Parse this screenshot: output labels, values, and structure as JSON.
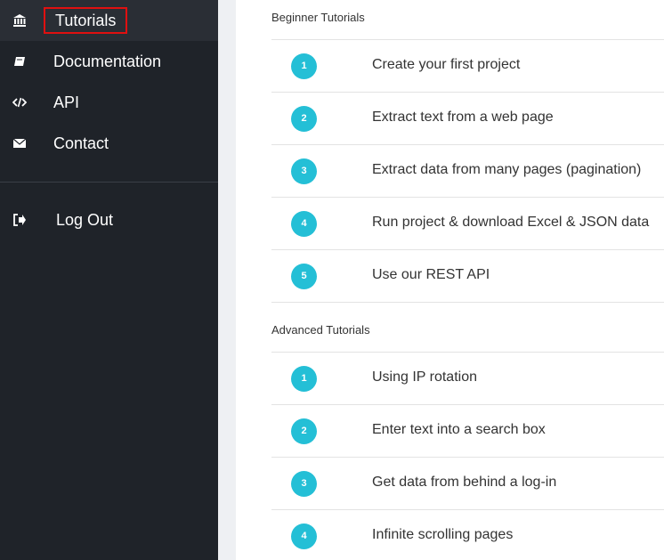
{
  "sidebar": {
    "items": [
      {
        "label": "Tutorials",
        "icon": "bank-icon"
      },
      {
        "label": "Documentation",
        "icon": "book-icon"
      },
      {
        "label": "API",
        "icon": "code-icon"
      },
      {
        "label": "Contact",
        "icon": "envelope-icon"
      }
    ],
    "logout": {
      "label": "Log Out",
      "icon": "sign-out-icon"
    }
  },
  "beginner": {
    "title": "Beginner Tutorials",
    "items": [
      {
        "num": "1",
        "label": "Create your first project"
      },
      {
        "num": "2",
        "label": "Extract text from a web page"
      },
      {
        "num": "3",
        "label": "Extract data from many pages (pagination)"
      },
      {
        "num": "4",
        "label": "Run project & download Excel & JSON data"
      },
      {
        "num": "5",
        "label": "Use our REST API"
      }
    ]
  },
  "advanced": {
    "title": "Advanced Tutorials",
    "items": [
      {
        "num": "1",
        "label": "Using IP rotation"
      },
      {
        "num": "2",
        "label": "Enter text into a search box"
      },
      {
        "num": "3",
        "label": "Get data from behind a log-in"
      },
      {
        "num": "4",
        "label": "Infinite scrolling pages"
      }
    ]
  },
  "colors": {
    "sidebar_bg": "#1f2329",
    "badge": "#24bfd6",
    "highlight": "#e01010"
  }
}
